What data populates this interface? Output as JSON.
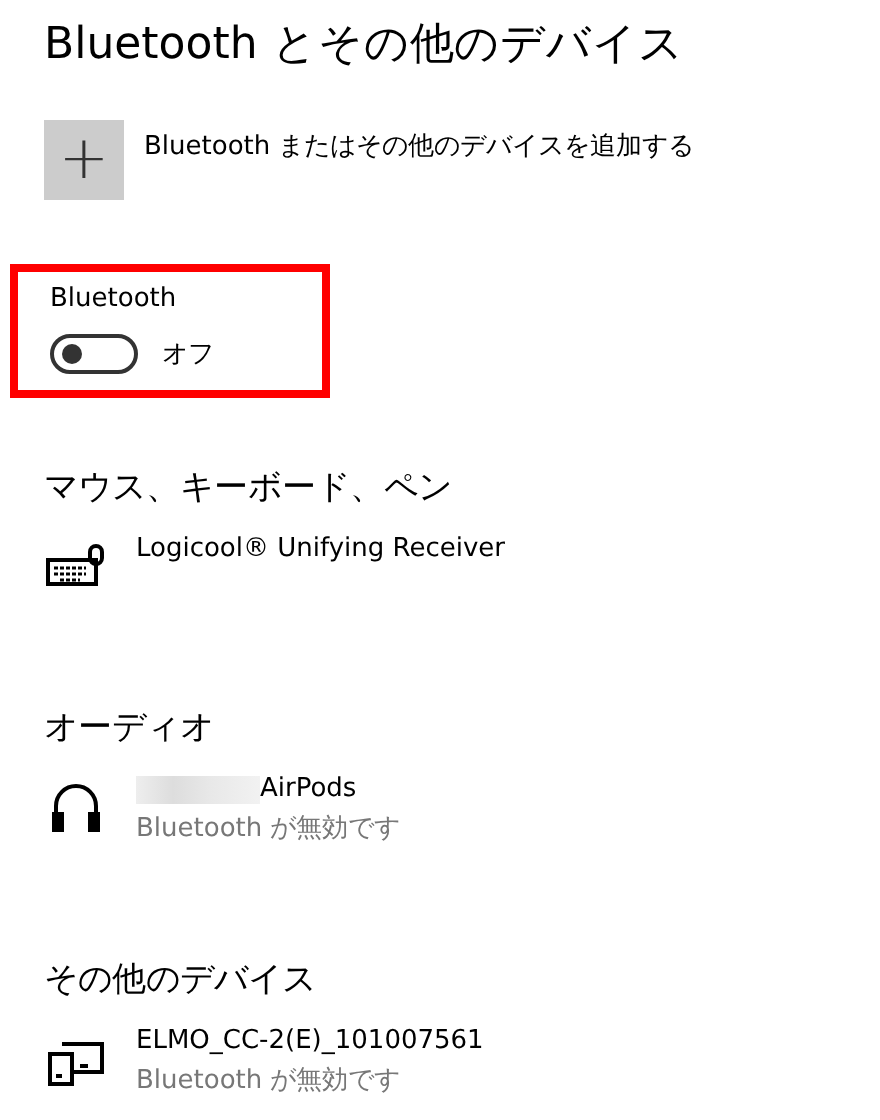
{
  "title": "Bluetooth とその他のデバイス",
  "add_button": {
    "label": "+",
    "text": "Bluetooth またはその他のデバイスを追加する"
  },
  "bluetooth": {
    "label": "Bluetooth",
    "on": false,
    "state_text": "オフ",
    "highlighted": true
  },
  "sections": [
    {
      "heading": "マウス、キーボード、ペン",
      "devices": [
        {
          "kind": "keyboard",
          "name": "Logicool® Unifying Receiver",
          "redacted": false
        }
      ]
    },
    {
      "heading": "オーディオ",
      "devices": [
        {
          "kind": "headphones",
          "name": "AirPods",
          "redacted": true,
          "status": "Bluetooth が無効です"
        }
      ]
    },
    {
      "heading": "その他のデバイス",
      "devices": [
        {
          "kind": "device",
          "name": "ELMO_CC-2(E)_101007561",
          "redacted": false,
          "status": "Bluetooth が無効です"
        }
      ]
    }
  ]
}
